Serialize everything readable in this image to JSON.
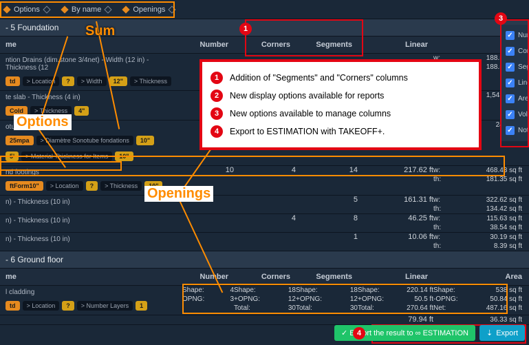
{
  "topbar": {
    "filters": [
      {
        "label": "Options"
      },
      {
        "label": "By name"
      },
      {
        "label": "Openings"
      }
    ]
  },
  "column_panel": {
    "options": [
      {
        "label": "Num",
        "checked": true
      },
      {
        "label": "Corn",
        "checked": true
      },
      {
        "label": "Seg",
        "checked": true
      },
      {
        "label": "Line",
        "checked": true
      },
      {
        "label": "Are",
        "checked": true
      },
      {
        "label": "Volu",
        "checked": true
      },
      {
        "label": "Note",
        "checked": true
      }
    ]
  },
  "columns": {
    "name": "me",
    "number": "Number",
    "corners": "Corners",
    "segments": "Segments",
    "linear": "Linear",
    "area": "Are"
  },
  "sections": [
    {
      "title": "- 5 Foundation",
      "items": [
        {
          "desc": "ntion Drains (dim.stone 3/4net) - Width (12 in) - Thickness (12",
          "tags": [
            {
              "text": "td",
              "cls": "orange"
            },
            {
              "text": "> Location",
              "cls": "dark"
            },
            {
              "text": "?",
              "cls": "yellow"
            },
            {
              "text": "> Width",
              "cls": "dark"
            },
            {
              "text": "12\"",
              "cls": "yellow"
            },
            {
              "text": "> Thickness",
              "cls": "dark"
            }
          ],
          "number": "",
          "corners": "",
          "segments": "",
          "linear": "",
          "area": [
            {
              "l": "w:",
              "v": "188.53 sq ft"
            },
            {
              "l": "th:",
              "v": "188.53 sq ft"
            }
          ]
        },
        {
          "desc": "te slab - Thickness (4 in)",
          "tags": [
            {
              "text": "Cold",
              "cls": "orange"
            },
            {
              "text": "> Thickness",
              "cls": "dark"
            },
            {
              "text": "4\"",
              "cls": "yellow"
            }
          ],
          "number": "",
          "corners": "",
          "segments": "",
          "linear": "",
          "area": [
            {
              "l": "",
              "v": "1,543.79 sq"
            }
          ]
        },
        {
          "desc": "otubes (10 in)",
          "tags": [
            {
              "text": "25mpa",
              "cls": "orange"
            },
            {
              "text": "> Diamètre Sonotube fondations",
              "cls": "dark"
            },
            {
              "text": "10\"",
              "cls": "yellow"
            }
          ],
          "moretags": [
            {
              "text": "5'",
              "cls": "yellow"
            },
            {
              "text": "> Material Thickness for Items",
              "cls": "dark"
            },
            {
              "text": "10\"",
              "cls": "yellow"
            }
          ],
          "number": "",
          "corners": "",
          "segments": "",
          "linear": "",
          "area": [
            {
              "l": "",
              "v": "24.96 sq"
            }
          ]
        },
        {
          "desc": "nd footings",
          "tags": [
            {
              "text": "ftForm10\"",
              "cls": "orange"
            },
            {
              "text": "> Location",
              "cls": "dark"
            },
            {
              "text": "?",
              "cls": "yellow"
            },
            {
              "text": "> Thickness",
              "cls": "dark"
            },
            {
              "text": "10\"",
              "cls": "yellow"
            }
          ],
          "number": "10",
          "corners": "4",
          "segments": "14",
          "linear": "217.62 ft",
          "area": [
            {
              "l": "w:",
              "v": "468.43 sq ft"
            },
            {
              "l": "th:",
              "v": "181.35 sq ft"
            }
          ]
        },
        {
          "desc": "n) - Thickness (10 in)",
          "number": "",
          "corners": "",
          "segments": "5",
          "linear": "161.31 ft",
          "area": [
            {
              "l": "w:",
              "v": "322.62 sq ft"
            },
            {
              "l": "th:",
              "v": "134.42 sq ft"
            }
          ]
        },
        {
          "desc": "n) - Thickness (10 in)",
          "number": "",
          "corners": "4",
          "segments": "8",
          "linear": "46.25 ft",
          "area": [
            {
              "l": "w:",
              "v": "115.63 sq ft"
            },
            {
              "l": "th:",
              "v": "38.54 sq ft"
            }
          ]
        },
        {
          "desc": "n) - Thickness (10 in)",
          "number": "",
          "corners": "",
          "segments": "1",
          "linear": "10.06 ft",
          "area": [
            {
              "l": "w:",
              "v": "30.19 sq ft"
            },
            {
              "l": "th:",
              "v": "8.39 sq ft"
            }
          ]
        }
      ]
    },
    {
      "title": "- 6 Ground floor",
      "items": [
        {
          "desc": "l cladding",
          "tags": [
            {
              "text": "td",
              "cls": "orange"
            },
            {
              "text": "> Location",
              "cls": "dark"
            },
            {
              "text": "?",
              "cls": "yellow"
            },
            {
              "text": "> Number Layers",
              "cls": "dark"
            },
            {
              "text": "1",
              "cls": "yellow"
            }
          ],
          "multi": {
            "number": [
              {
                "l": "Shape:",
                "v": "4"
              },
              {
                "l": "OPNG:",
                "v": "3"
              }
            ],
            "corners": [
              {
                "l": "Shape:",
                "v": "18"
              },
              {
                "l": "+OPNG:",
                "v": "12"
              },
              {
                "l": "Total:",
                "v": "30"
              }
            ],
            "segments": [
              {
                "l": "Shape:",
                "v": "18"
              },
              {
                "l": "+OPNG:",
                "v": "12"
              },
              {
                "l": "Total:",
                "v": "30"
              }
            ],
            "linear": [
              {
                "l": "Shape:",
                "v": "220.14 ft"
              },
              {
                "l": "+OPNG:",
                "v": "50.5 ft"
              },
              {
                "l": "Total:",
                "v": "270.64 ft"
              }
            ],
            "area": [
              {
                "l": "Shape:",
                "v": "538 sq ft"
              },
              {
                "l": "-OPNG:",
                "v": "50.84 sq ft"
              },
              {
                "l": "Net:",
                "v": "487.16 sq ft"
              }
            ]
          }
        },
        {
          "desc": "",
          "number": "",
          "corners": "",
          "segments": "",
          "linear": "79.94 ft",
          "area": [
            {
              "l": "",
              "v": "36.33 sq ft"
            }
          ]
        }
      ]
    }
  ],
  "callout": {
    "items": [
      "Addition of \"Segments\" and \"Corners\" columns",
      "New display options available for reports",
      "New options available to manage columns",
      "Export to ESTIMATION with TAKEOFF+."
    ]
  },
  "annotations": {
    "sum": "Sum",
    "options": "Options",
    "openings": "Openings"
  },
  "footer": {
    "export_result": "✓ Export the result to ∞ ESTIMATION",
    "export": "Export"
  }
}
